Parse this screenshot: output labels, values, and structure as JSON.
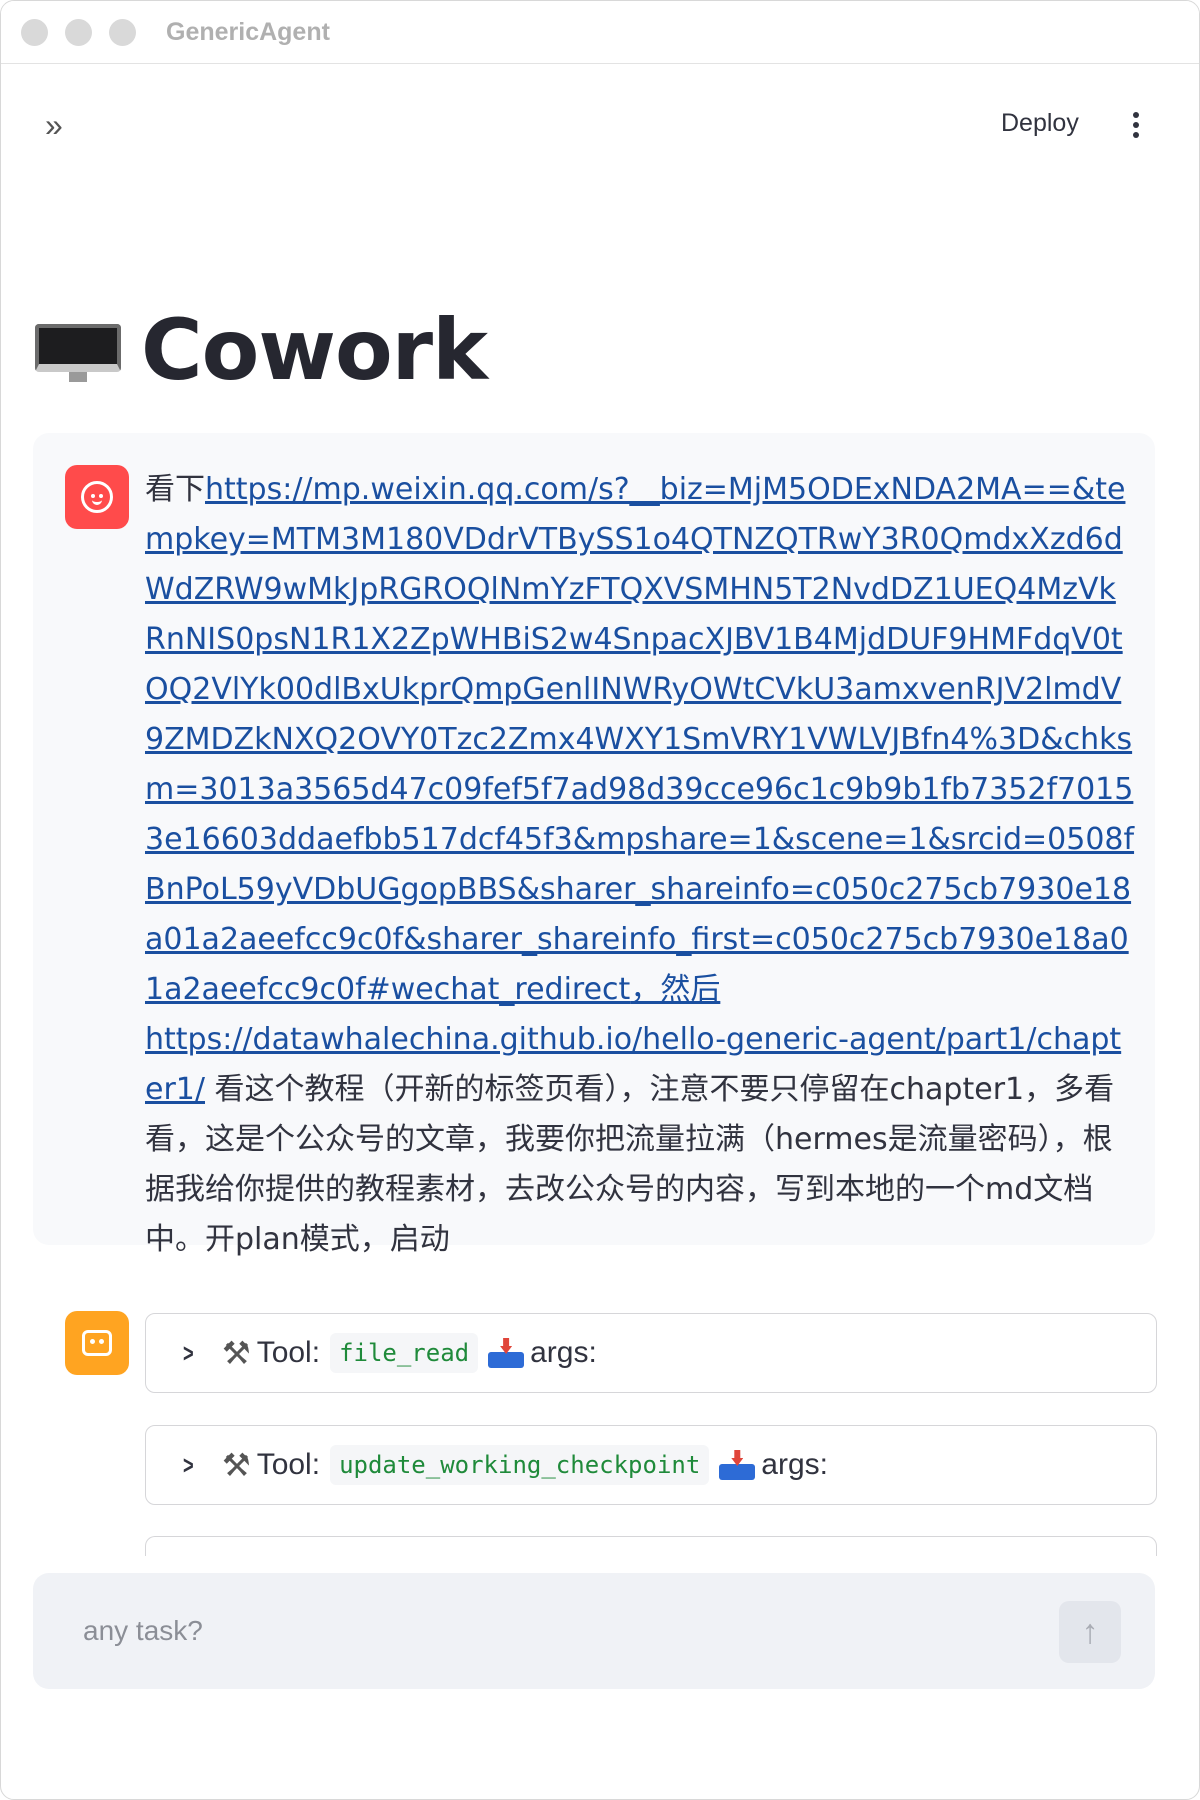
{
  "window": {
    "title": "GenericAgent"
  },
  "header": {
    "deploy_label": "Deploy",
    "expand_icon": "»"
  },
  "page": {
    "title": "Cowork",
    "title_icon": "desktop-computer"
  },
  "user_message": {
    "prefix": "看下",
    "link1": "https://mp.weixin.qq.com/s?__biz=MjM5ODExNDA2MA==&tempkey=MTM3M180VDdrVTBySS1o4QTNZQTRwY3R0QmdxXzd6dWdZRW9wMkJpRGROQlNmYzFTQXVSMHN5T2NvdDZ1UEQ4MzVkRnNIS0psN1R1X2ZpWHBiS2w4SnpacXJBV1B4MjdDUF9HMFdqV0tOQ2VlYk00dlBxUkprQmpGenlINWRyOWtCVkU3amxvenRJV2lmdV9ZMDZkNXQ2OVY0Tzc2Zmx4WXY1SmVRY1VWLVJBfn4%3D&chksm=3013a3565d47c09fef5f7ad98d39cce96c1c9b9b1fb7352f70153e16603ddaefbb517dcf45f3&mpshare=1&scene=1&srcid=0508fBnPoL59yVDbUGgopBBS&sharer_shareinfo=c050c275cb7930e18a01a2aeefcc9c0f&sharer_shareinfo_first=c050c275cb7930e18a01a2aeefcc9c0f#wechat_redirect",
    "middle": "，然后",
    "link2": "https://datawhalechina.github.io/hello-generic-agent/part1/chapter1/",
    "suffix": " 看这个教程（开新的标签页看），注意不要只停留在chapter1，多看看，这是个公众号的文章，我要你把流量拉满（hermes是流量密码），根据我给你提供的教程素材，去改公众号的内容，写到本地的一个md文档中。开plan模式，启动"
  },
  "tool_calls": [
    {
      "tool_label": "Tool:",
      "tool_name": "file_read",
      "args_label": "args:"
    },
    {
      "tool_label": "Tool:",
      "tool_name": "update_working_checkpoint",
      "args_label": "args:"
    }
  ],
  "chat_input": {
    "placeholder": "any task?"
  },
  "colors": {
    "user_avatar": "#ff4b4b",
    "bot_avatar": "#ffa421",
    "link": "#1a4fa0",
    "code": "#1f8a3a"
  }
}
